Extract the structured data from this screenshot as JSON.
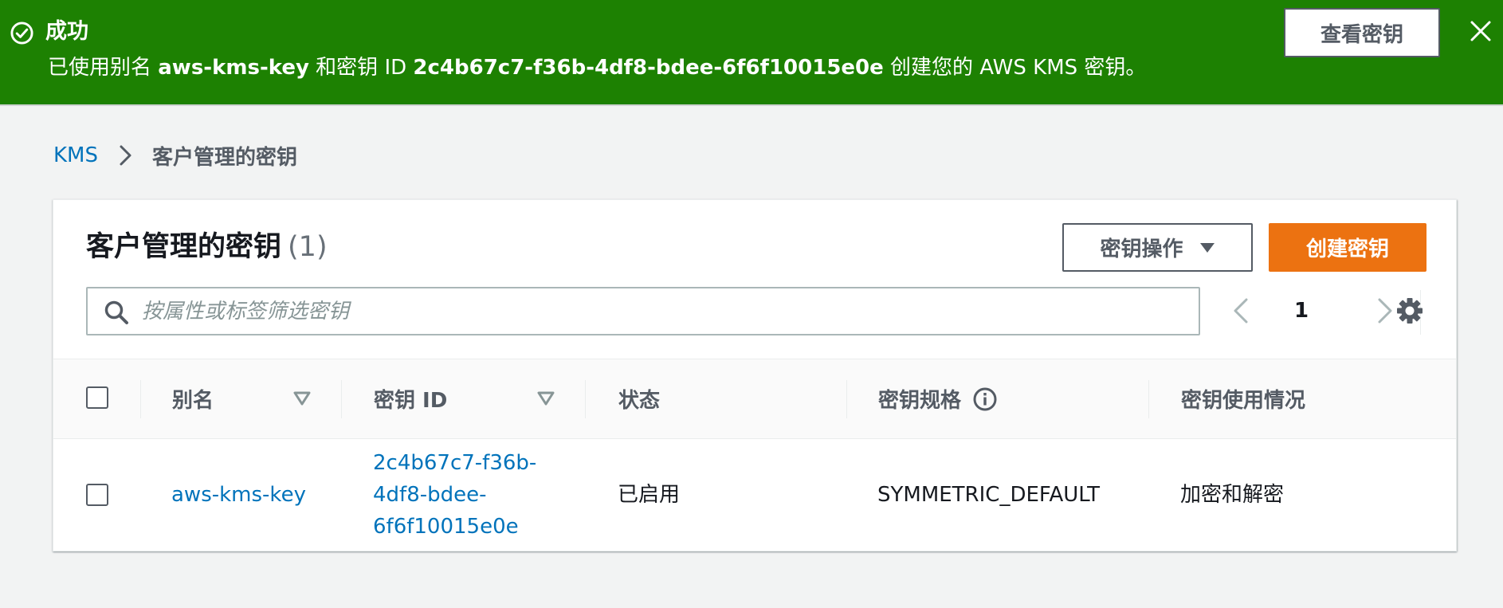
{
  "flash": {
    "title": "成功",
    "message_prefix": "已使用别名 ",
    "alias": "aws-kms-key",
    "message_mid": " 和密钥 ID ",
    "key_id": "2c4b67c7-f36b-4df8-bdee-6f6f10015e0e",
    "message_suffix": " 创建您的 AWS KMS 密钥。",
    "view_button": "查看密钥",
    "color": "#1d8102"
  },
  "breadcrumb": {
    "root": "KMS",
    "current": "客户管理的密钥"
  },
  "panel": {
    "title": "客户管理的密钥",
    "count": "(1)",
    "actions_button": "密钥操作",
    "create_button": "创建密钥",
    "create_color": "#ec7211",
    "filter_placeholder": "按属性或标签筛选密钥",
    "page": "1"
  },
  "table": {
    "columns": {
      "alias": "别名",
      "key_id": "密钥 ID",
      "status": "状态",
      "key_spec": "密钥规格",
      "usage": "密钥使用情况"
    },
    "rows": [
      {
        "alias": "aws-kms-key",
        "key_id_line1": "2c4b67c7-f36b-",
        "key_id_line2": "4df8-bdee-",
        "key_id_line3": "6f6f10015e0e",
        "status": "已启用",
        "key_spec": "SYMMETRIC_DEFAULT",
        "usage": "加密和解密"
      }
    ]
  },
  "icons": [
    "check-circle-icon",
    "close-icon",
    "chevron-right-icon",
    "caret-down-icon",
    "search-icon",
    "chevron-left-icon",
    "settings-icon",
    "sort-icon",
    "info-icon"
  ]
}
